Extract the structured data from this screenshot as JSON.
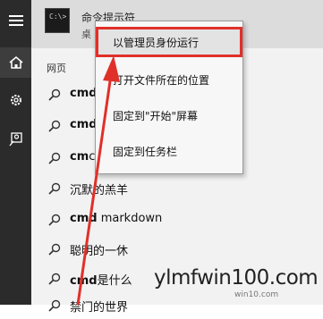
{
  "rail": {
    "items": [
      {
        "icon": "hamburger-menu-icon"
      },
      {
        "icon": "home-icon",
        "active": true
      },
      {
        "icon": "gear-icon"
      },
      {
        "icon": "feedback-icon"
      }
    ]
  },
  "top_result": {
    "title": "命令提示符",
    "subtitle": "桌",
    "icon": "command-prompt-icon",
    "prompt_glyph": "C:\\>"
  },
  "section_label": "网页",
  "results": [
    {
      "bold": "cmd",
      "rest": ""
    },
    {
      "bold": "cmd",
      "rest": ""
    },
    {
      "bold": "cm",
      "rest": "c"
    },
    {
      "bold": "",
      "rest": "沉默的羔羊"
    },
    {
      "bold": "cmd",
      "rest": " markdown"
    },
    {
      "bold": "",
      "rest": "聪明的一休"
    },
    {
      "bold": "cmd",
      "rest": "是什么"
    },
    {
      "bold": "",
      "rest": "禁门的世界"
    }
  ],
  "context_menu": {
    "items": [
      {
        "label": "以管理员身份运行",
        "highlighted": true
      },
      {
        "label": "打开文件所在的位置"
      },
      {
        "label": "固定到\"开始\"屏幕"
      },
      {
        "label": "固定到任务栏"
      }
    ]
  },
  "annotation": {
    "color": "#e0302a"
  },
  "watermark": {
    "text": "ylmfwin100.com",
    "small": "win10.com"
  }
}
